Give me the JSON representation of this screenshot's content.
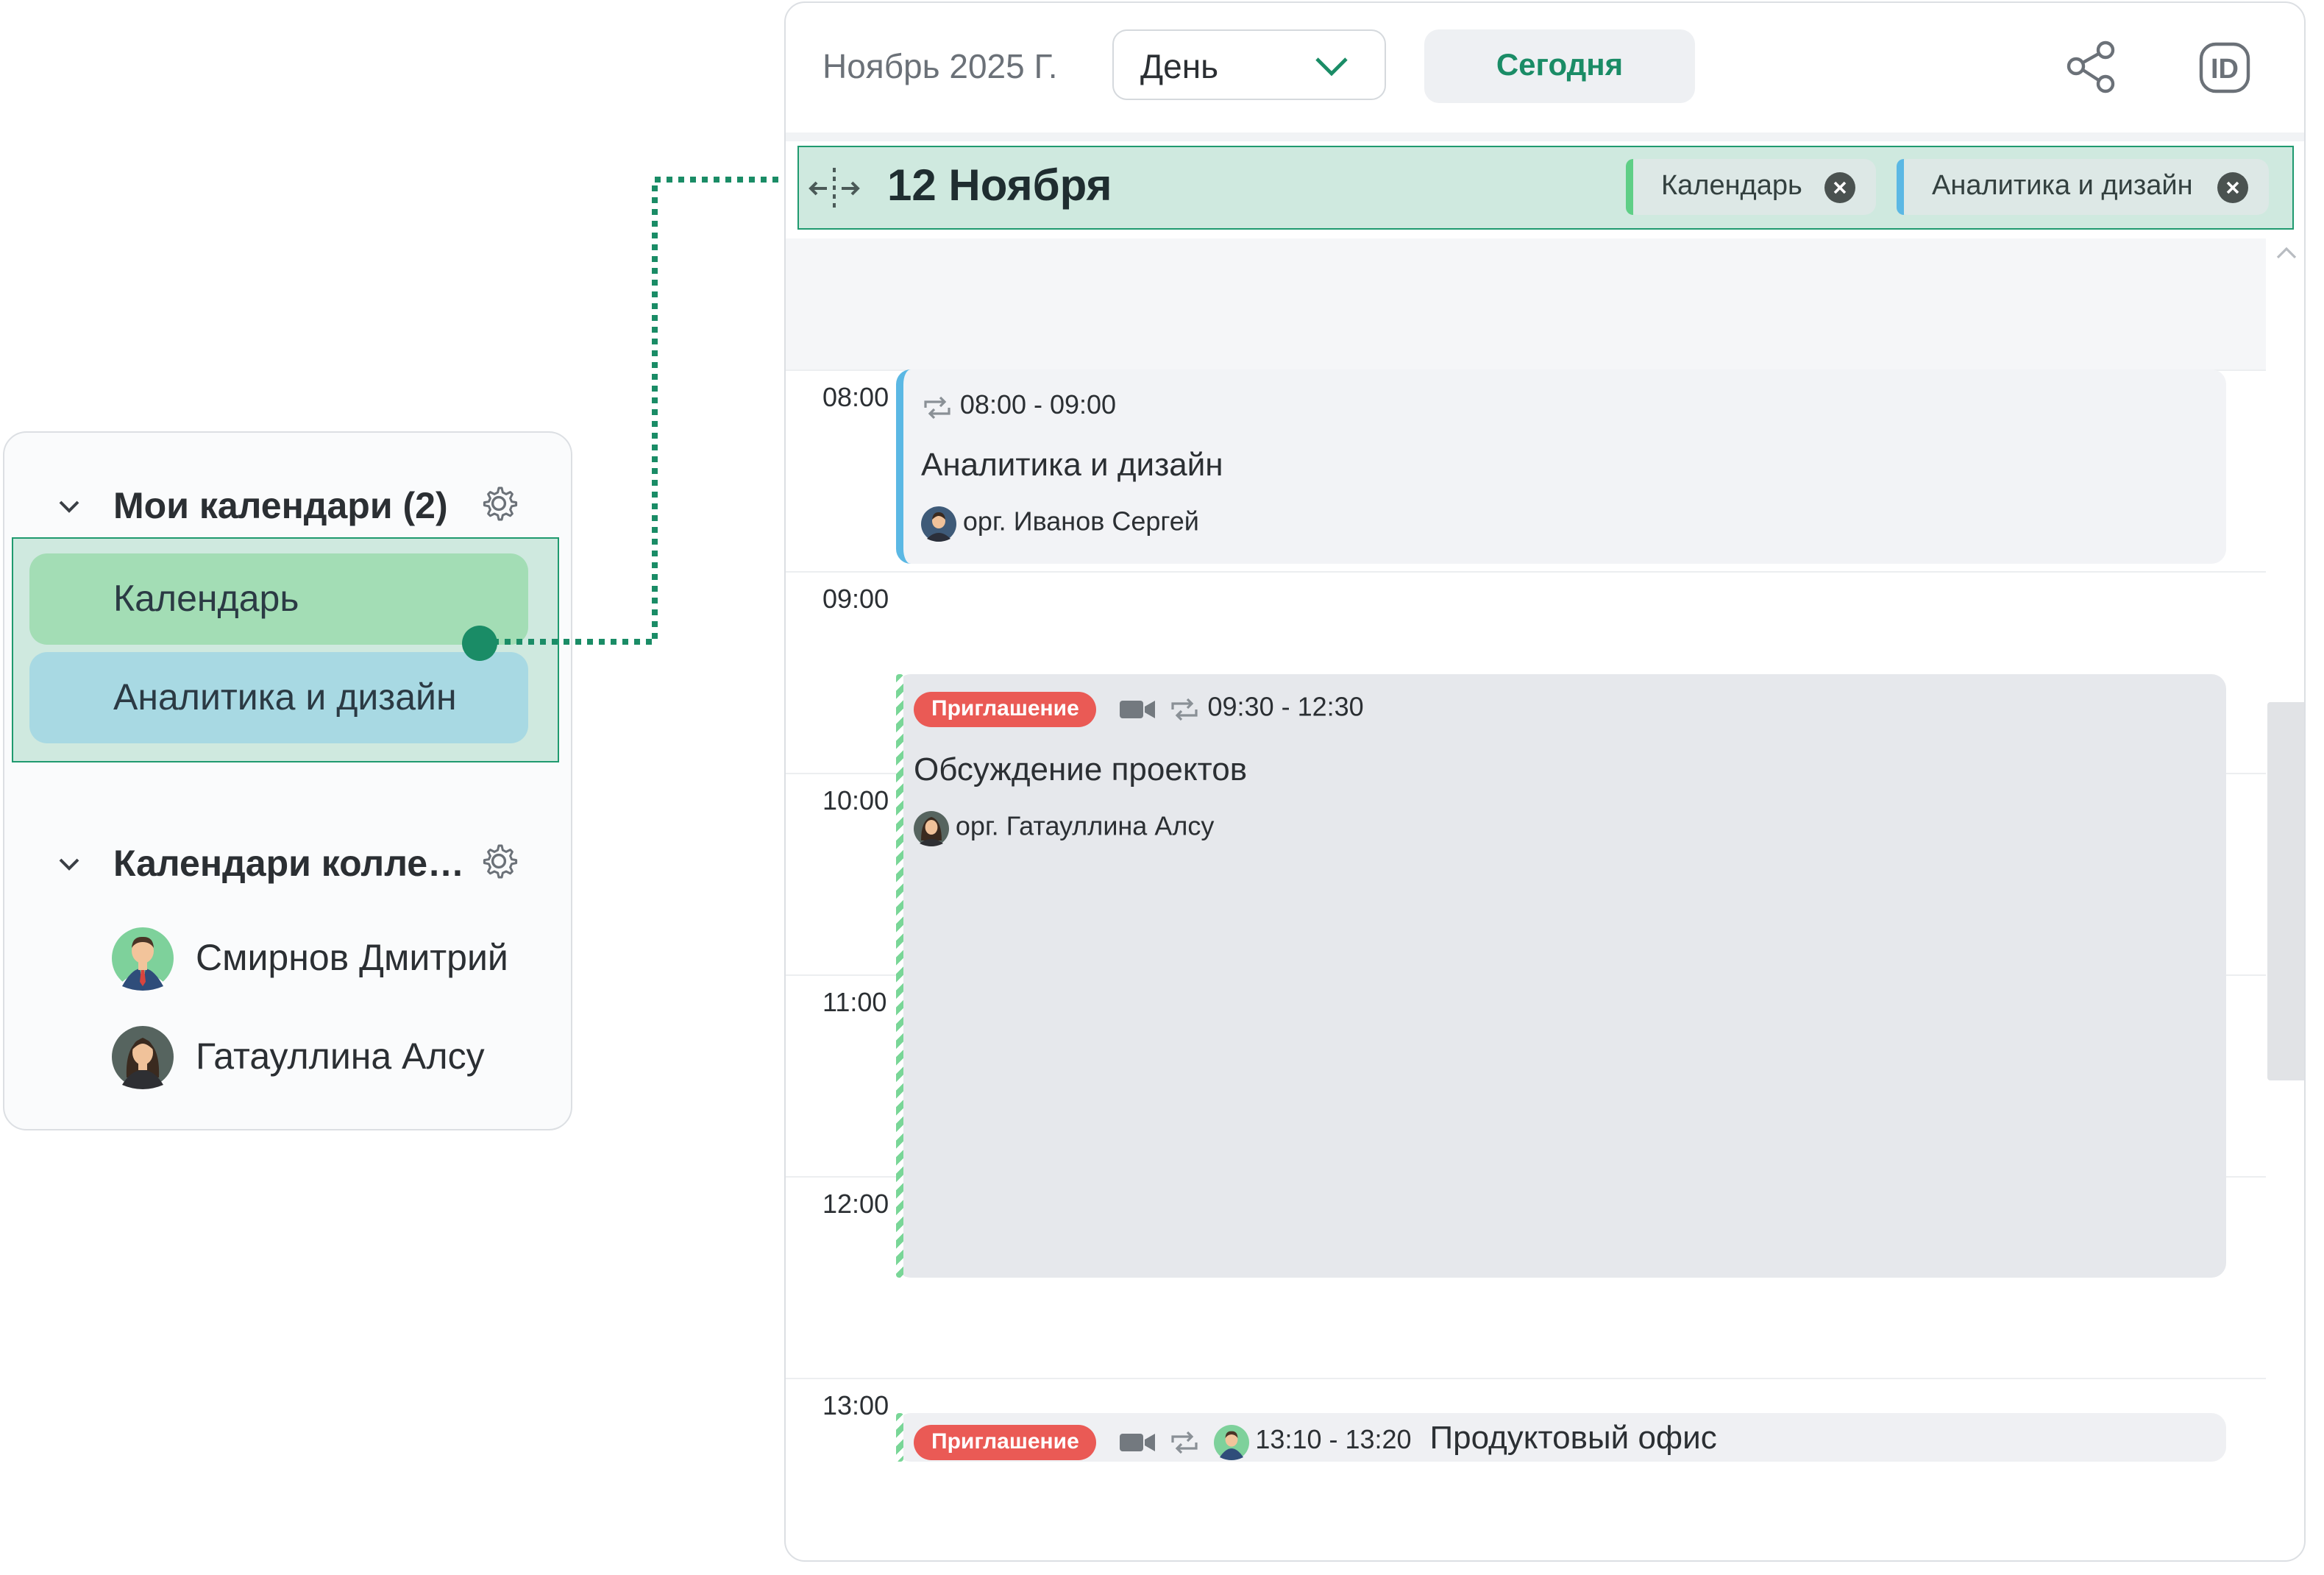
{
  "sidebar": {
    "my_calendars": {
      "title": "Мои календари (2)",
      "items": [
        {
          "label": "Календарь",
          "color": "#a3ddb5"
        },
        {
          "label": "Аналитика и дизайн",
          "color": "#a8d9e3"
        }
      ]
    },
    "colleague_calendars": {
      "title": "Календари коллег (...",
      "items": [
        {
          "name": "Смирнов Дмитрий",
          "avatar": "man-avatar-icon"
        },
        {
          "name": "Гатауллина Алсу",
          "avatar": "woman-avatar-icon"
        }
      ]
    }
  },
  "header": {
    "month": "Ноябрь 2025 Г.",
    "view_select": {
      "value": "День"
    },
    "today_button": "Сегодня",
    "icons": [
      "share-icon",
      "id-icon"
    ]
  },
  "date_bar": {
    "date": "12 Ноября",
    "chips": [
      {
        "label": "Календарь",
        "color": "#5fcf86"
      },
      {
        "label": "Аналитика и дизайн",
        "color": "#5bb8e4"
      }
    ]
  },
  "time_labels": [
    "08:00",
    "09:00",
    "10:00",
    "11:00",
    "12:00",
    "13:00"
  ],
  "events": [
    {
      "time": "08:00 - 09:00",
      "title": "Аналитика и дизайн",
      "organizer": "орг. Иванов Сергей",
      "color": "#5bb8e4"
    },
    {
      "badge": "Приглашение",
      "time": "09:30 - 12:30",
      "title": "Обсуждение проектов",
      "organizer": "орг. Гатауллина Алсу",
      "has_video": true
    },
    {
      "badge": "Приглашение",
      "time": "13:10 - 13:20",
      "title": "Продуктовый офис",
      "has_video": true
    }
  ],
  "colors": {
    "accent": "#1a8c66",
    "highlight": "#cfe9df",
    "badge": "#ea5a55"
  }
}
